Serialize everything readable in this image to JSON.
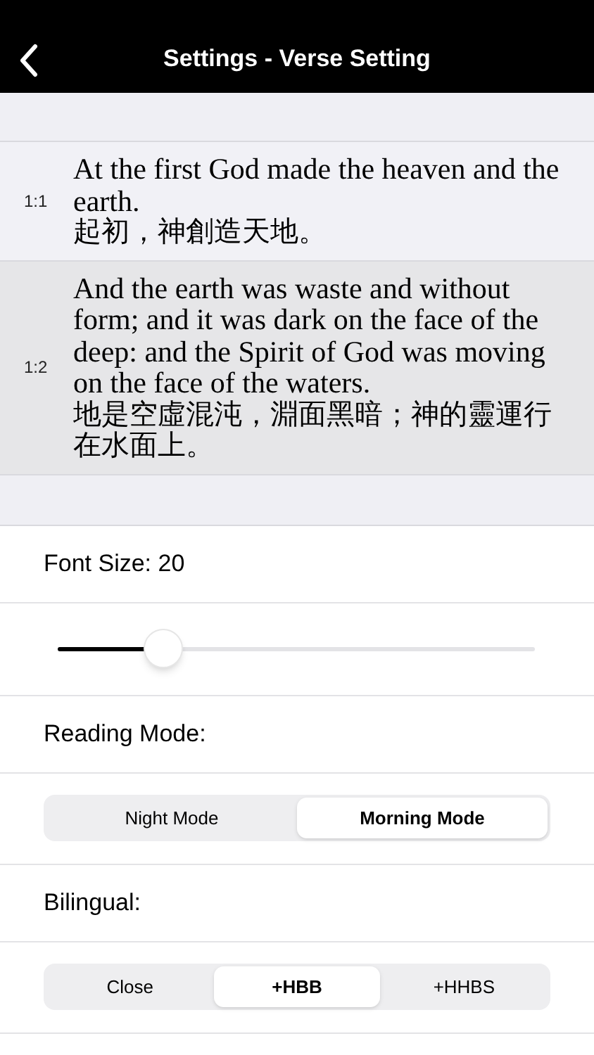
{
  "nav_bar": {
    "title": "Settings - Verse Setting"
  },
  "verses": [
    {
      "number": "1:1",
      "english": "At the first God made the heaven and the earth.",
      "chinese": "起初，神創造天地。",
      "selected": false
    },
    {
      "number": "1:2",
      "english": "And the earth was waste and without form; and it was dark on the face of the deep: and the Spirit of God was moving on the face of the waters.",
      "chinese": "地是空虛混沌，淵面黑暗；神的靈運行在水面上。",
      "selected": true
    }
  ],
  "font_size": {
    "label": "Font Size: 20",
    "level": 0.22
  },
  "reading_mode": {
    "label": "Reading Mode:",
    "options": [
      {
        "label": "Night Mode",
        "selected": false
      },
      {
        "label": "Morning Mode",
        "selected": true
      }
    ]
  },
  "bilingual": {
    "label": "Bilingual:",
    "options": [
      {
        "label": "Close",
        "selected": false
      },
      {
        "label": "+HBB",
        "selected": true
      },
      {
        "label": "+HHBS",
        "selected": false
      }
    ]
  }
}
